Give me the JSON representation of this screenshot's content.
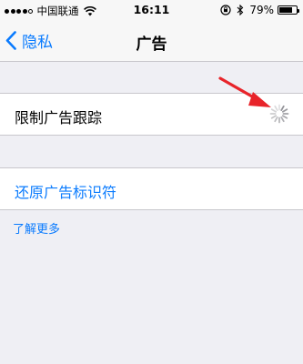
{
  "status_bar": {
    "carrier": "中国联通",
    "time": "16:11",
    "battery_percent": "79%",
    "battery_level": 0.79,
    "signal_bars_filled": 4,
    "signal_bars_total": 5
  },
  "nav": {
    "back_label": "隐私",
    "title": "广告"
  },
  "settings": {
    "limit_ad_tracking_label": "限制广告跟踪",
    "reset_ad_identifier_label": "还原广告标识符"
  },
  "footer": {
    "learn_more_label": "了解更多"
  },
  "colors": {
    "accent": "#0a7bfe",
    "annotation_arrow": "#e8242a",
    "background": "#efeff4"
  },
  "icons": {
    "wifi": "wifi-icon",
    "rotation_lock": "rotation-lock-icon",
    "bluetooth": "bluetooth-icon",
    "battery": "battery-icon",
    "back": "chevron-left-icon",
    "loading": "loading-spinner-icon",
    "annotation": "red-arrow-annotation"
  }
}
